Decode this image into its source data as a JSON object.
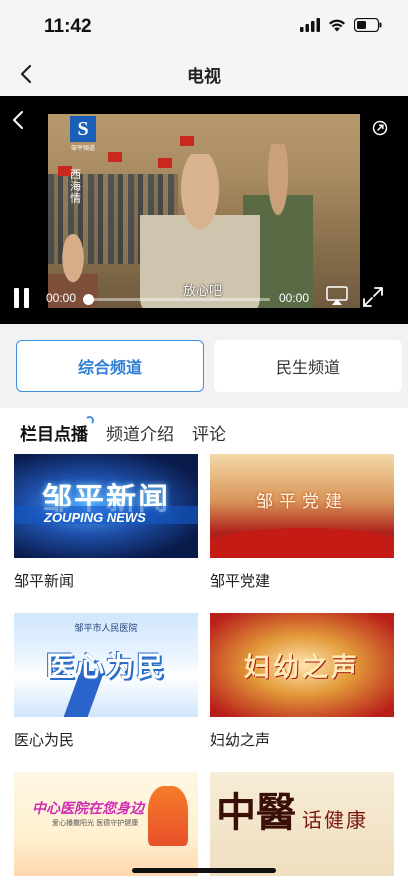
{
  "status_bar": {
    "time": "11:42"
  },
  "nav": {
    "title": "电视"
  },
  "player": {
    "channel_logo": "S",
    "channel_logo_text": "邹平頻道",
    "drama_title": "西海情",
    "subtitle": "放心吧",
    "current_time": "00:00",
    "total_time": "00:00",
    "progress": 0
  },
  "channel_tabs": [
    {
      "label": "综合频道",
      "active": true
    },
    {
      "label": "民生频道",
      "active": false
    }
  ],
  "sub_tabs": [
    {
      "label": "栏目点播",
      "active": true
    },
    {
      "label": "频道介绍",
      "active": false
    },
    {
      "label": "评论",
      "active": false
    }
  ],
  "programs": [
    {
      "label": "邹平新闻",
      "thumb_title": "邹平新闻",
      "thumb_sub": "ZOUPING NEWS"
    },
    {
      "label": "邹平党建",
      "thumb_title": "邹平党建"
    },
    {
      "label": "医心为民",
      "thumb_title": "医心为民",
      "thumb_sub": "邹平市人民医院"
    },
    {
      "label": "妇幼之声",
      "thumb_title": "妇幼之声"
    },
    {
      "label": "",
      "thumb_title": "中心医院在您身边",
      "thumb_sub": "爱心播撒阳光 医德守护健康"
    },
    {
      "label": "",
      "thumb_title": "中醫",
      "thumb_sub": "话健康"
    }
  ]
}
